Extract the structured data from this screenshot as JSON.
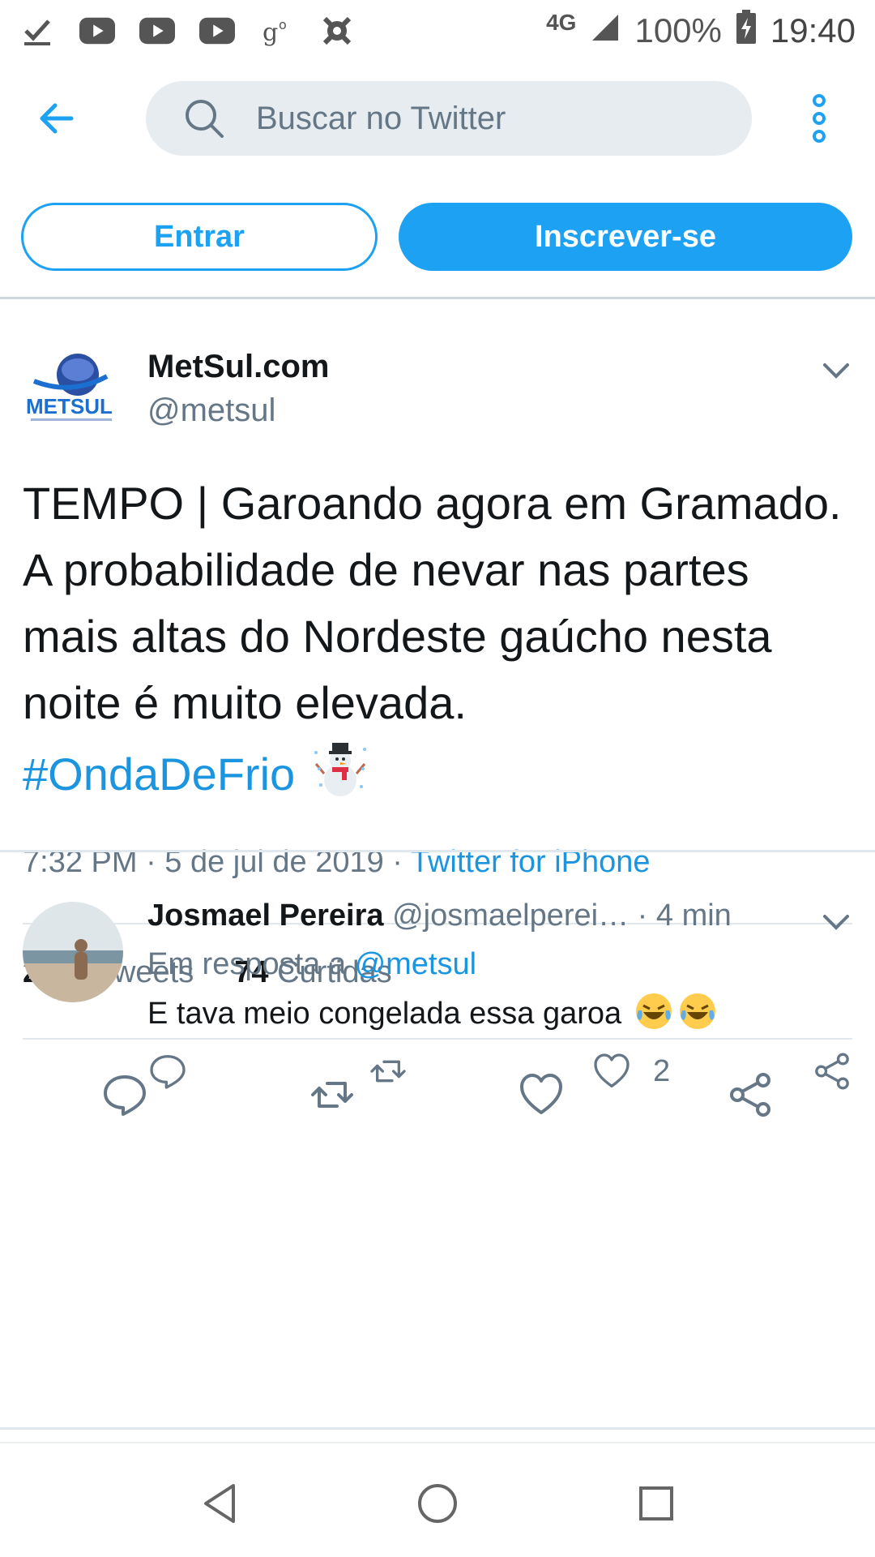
{
  "status_bar": {
    "icons": [
      "check-download-icon",
      "youtube-icon",
      "youtube-icon",
      "youtube-icon",
      "g-icon",
      "app-icon"
    ],
    "network": "4G",
    "battery": "100%",
    "time": "19:40"
  },
  "search": {
    "placeholder": "Buscar no Twitter"
  },
  "auth": {
    "login_label": "Entrar",
    "signup_label": "Inscrever-se"
  },
  "tweet": {
    "author_name": "MetSul.com",
    "author_handle": "@metsul",
    "logo_text": "METSUL",
    "text": "TEMPO | Garoando agora em Gramado. A probabilidade de nevar nas partes mais altas do Nordeste gaúcho nesta noite é muito elevada.",
    "hashtag": "#OndaDeFrio",
    "time": "7:32 PM · 5 de jul de 2019 · ",
    "source": "Twitter for iPhone",
    "retweets_count": "21",
    "retweets_label": "Retweets",
    "likes_count": "74",
    "likes_label": "Curtidas"
  },
  "reply": {
    "name": "Josmael Pereira",
    "handle": "@josmaelperei…",
    "time": "· 4 min",
    "in_reply_prefix": "Em resposta a ",
    "in_reply_mention": "@metsul",
    "text": "E tava meio congelada essa garoa",
    "likes": "2"
  },
  "colors": {
    "accent": "#1da1f2",
    "link": "#1b95e0",
    "muted": "#657786",
    "text": "#14171a"
  }
}
